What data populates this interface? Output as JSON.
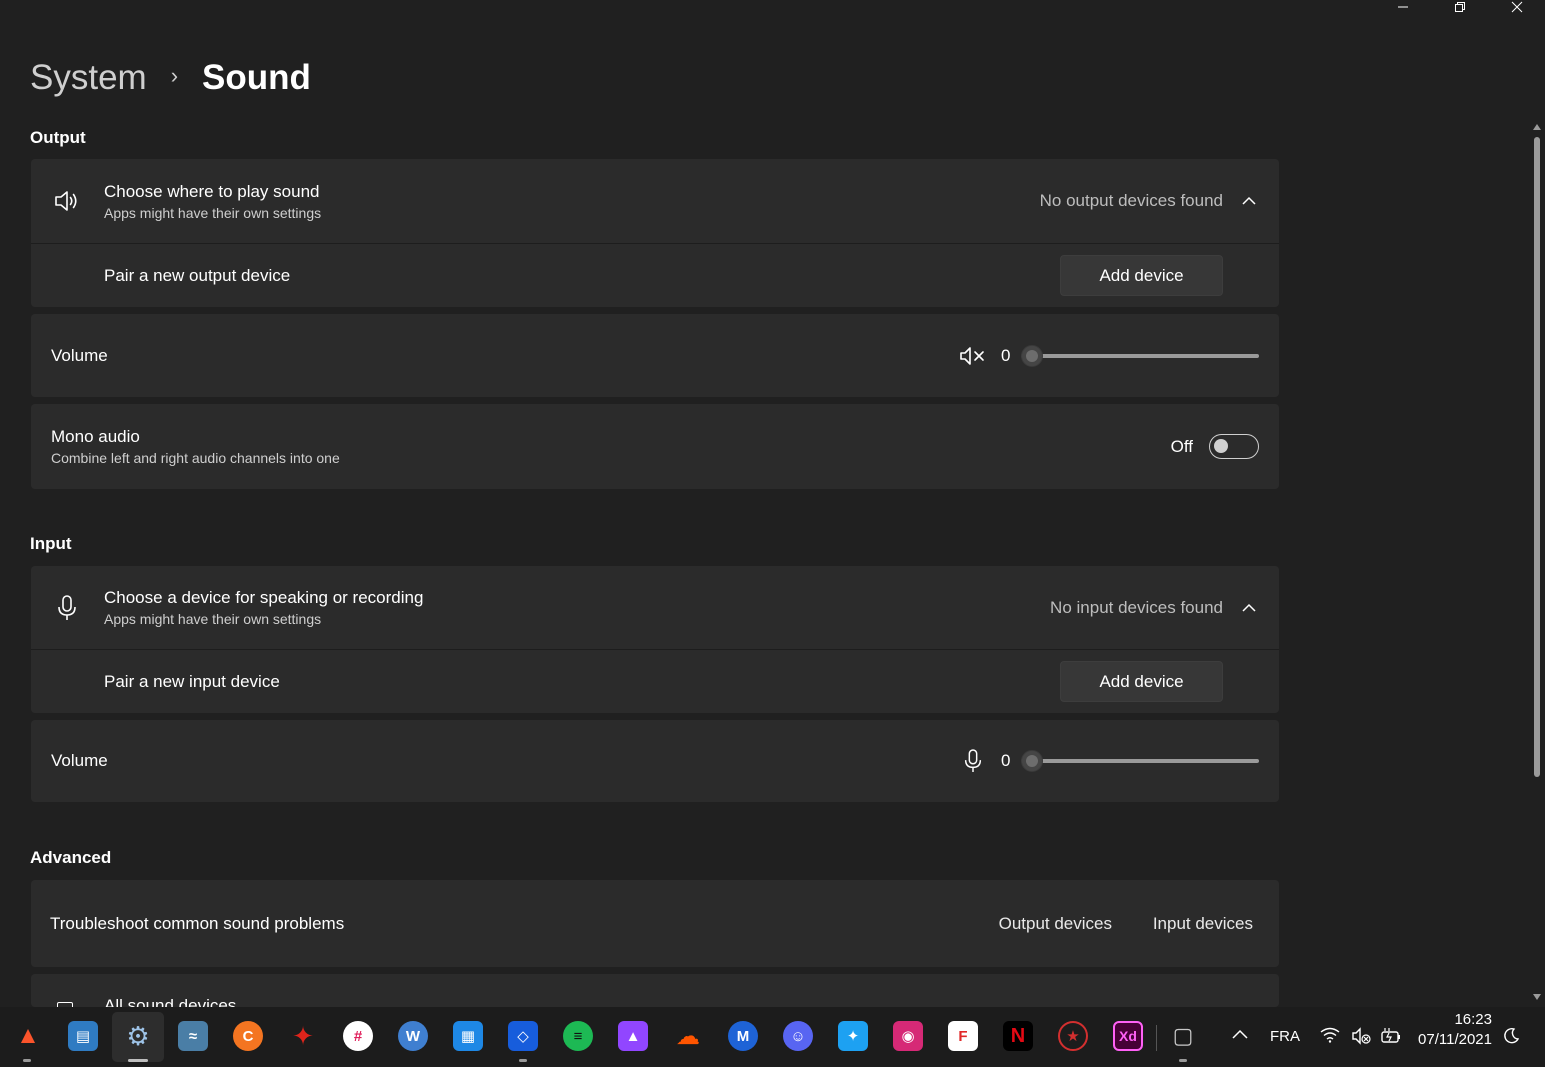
{
  "window": {
    "minimize_icon": "minimize-icon",
    "restore_icon": "restore-icon",
    "close_icon": "close-icon"
  },
  "breadcrumb": {
    "parent": "System",
    "separator": "›",
    "current": "Sound"
  },
  "output": {
    "section_title": "Output",
    "choose": {
      "title": "Choose where to play sound",
      "subtitle": "Apps might have their own settings",
      "status": "No output devices found",
      "icon": "speaker-icon"
    },
    "pair": {
      "label": "Pair a new output device",
      "button": "Add device"
    },
    "volume": {
      "label": "Volume",
      "value": "0",
      "level": 0,
      "icon": "speaker-muted-icon"
    },
    "mono": {
      "title": "Mono audio",
      "subtitle": "Combine left and right audio channels into one",
      "state_label": "Off",
      "on": false
    }
  },
  "input": {
    "section_title": "Input",
    "choose": {
      "title": "Choose a device for speaking or recording",
      "subtitle": "Apps might have their own settings",
      "status": "No input devices found",
      "icon": "microphone-icon"
    },
    "pair": {
      "label": "Pair a new input device",
      "button": "Add device"
    },
    "volume": {
      "label": "Volume",
      "value": "0",
      "level": 0,
      "icon": "microphone-icon"
    }
  },
  "advanced": {
    "section_title": "Advanced",
    "troubleshoot": {
      "label": "Troubleshoot common sound problems",
      "output_link": "Output devices",
      "input_link": "Input devices"
    },
    "all_devices": {
      "label": "All sound devices"
    }
  },
  "taskbar": {
    "apps": [
      {
        "name": "brave",
        "color": "#fb542b"
      },
      {
        "name": "control-panel",
        "color": "#3a8fd6"
      },
      {
        "name": "settings",
        "color": "#5b9bd5"
      },
      {
        "name": "resource-monitor",
        "color": "#6ca0c8"
      },
      {
        "name": "crunchyroll",
        "color": "#f47521"
      },
      {
        "name": "red-app",
        "color": "#e0241b"
      },
      {
        "name": "slack",
        "color": "#ffffff"
      },
      {
        "name": "word-app",
        "color": "#3f7fd0"
      },
      {
        "name": "remote-desktop",
        "color": "#1e88e5"
      },
      {
        "name": "bitwarden",
        "color": "#175ddc"
      },
      {
        "name": "spotify",
        "color": "#1db954"
      },
      {
        "name": "twitch",
        "color": "#9146ff"
      },
      {
        "name": "soundcloud",
        "color": "#ff5500"
      },
      {
        "name": "coinmarketcap",
        "color": "#1e63d6"
      },
      {
        "name": "discord",
        "color": "#5865f2"
      },
      {
        "name": "twitter",
        "color": "#1da1f2"
      },
      {
        "name": "instagram",
        "color": "#d62976"
      },
      {
        "name": "flipboard",
        "color": "#e12828"
      },
      {
        "name": "netflix",
        "color": "#e50914"
      },
      {
        "name": "red-shield-app",
        "color": "#d32f2f"
      },
      {
        "name": "adobe-xd",
        "color": "#ff61f6"
      },
      {
        "name": "device-manager",
        "color": "#9e9e9e"
      }
    ],
    "language": "FRA",
    "time": "16:23",
    "date": "07/11/2021"
  }
}
